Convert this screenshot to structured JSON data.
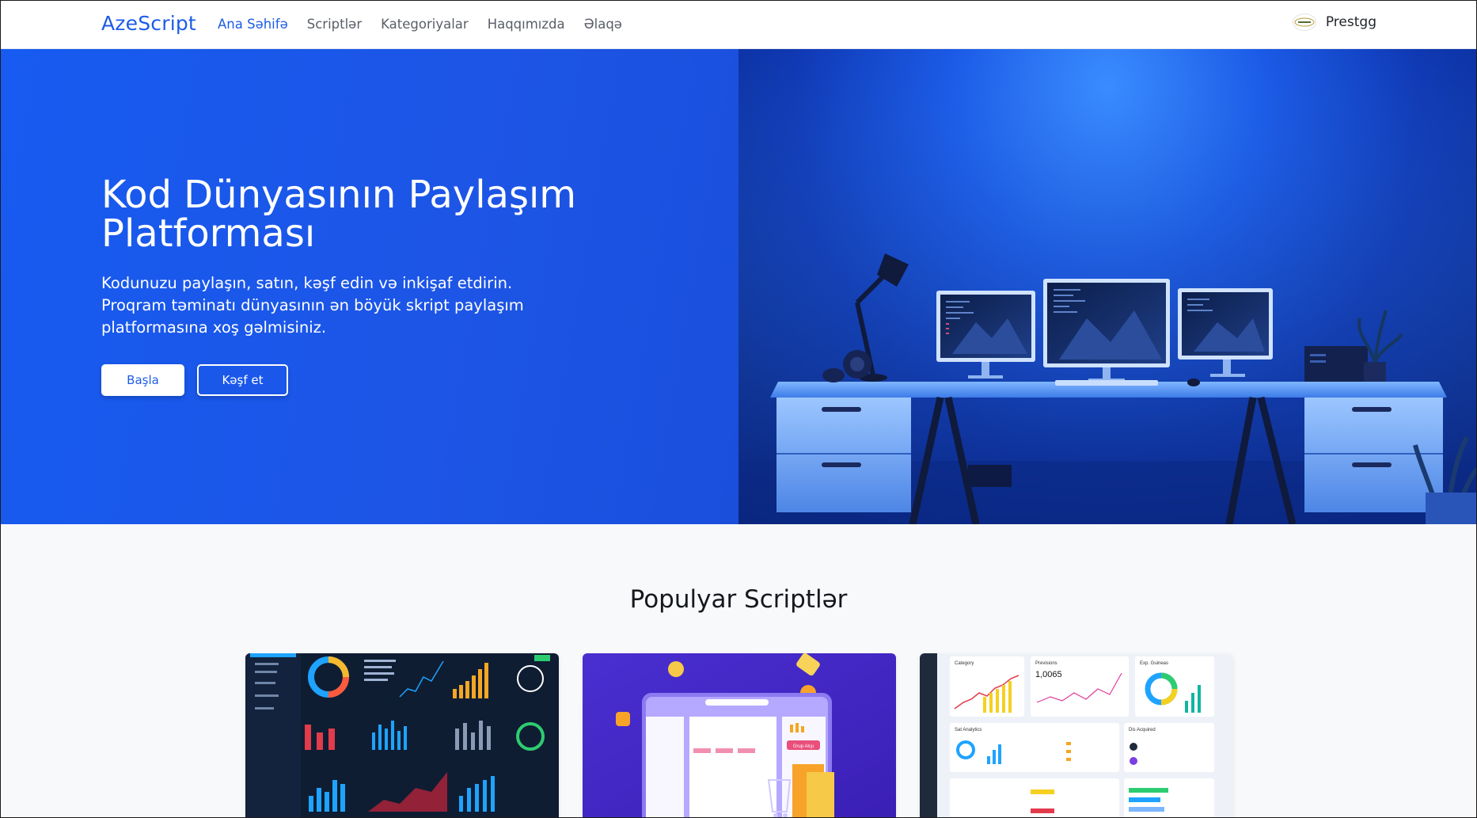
{
  "navbar": {
    "brand": "AzeScript",
    "links": [
      {
        "label": "Ana Səhifə",
        "active": true
      },
      {
        "label": "Scriptlər",
        "active": false
      },
      {
        "label": "Kategoriyalar",
        "active": false
      },
      {
        "label": "Haqqımızda",
        "active": false
      },
      {
        "label": "Əlaqə",
        "active": false
      }
    ],
    "user": {
      "name": "Prestgg",
      "avatar_icon": "user-avatar-icon"
    }
  },
  "hero": {
    "title": "Kod Dünyasının Paylaşım Platforması",
    "subtitle": "Kodunuzu paylaşın, satın, kəşf edin və inkişaf etdirin. Proqram təminatı dünyasının ən böyük skript paylaşım platformasına xoş gəlmisiniz.",
    "primary_button": "Başla",
    "secondary_button": "Kəşf et",
    "image_icon": "desk-setup-illustration"
  },
  "popular": {
    "title": "Populyar Scriptlər",
    "cards": [
      {
        "image": "dark-dashboard-thumbnail"
      },
      {
        "image": "ecommerce-purple-thumbnail",
        "button_text": "Grup Alışı"
      },
      {
        "image": "light-analytics-thumbnail",
        "widgets": [
          "Category",
          "Previsions",
          "Exp. Guineas",
          "Sat Analytics",
          "Dis Acquired"
        ],
        "big_number": "1,0065"
      }
    ]
  },
  "colors": {
    "accent": "#1d5ce6",
    "hero_bg": "#175bf0",
    "white": "#ffffff"
  }
}
